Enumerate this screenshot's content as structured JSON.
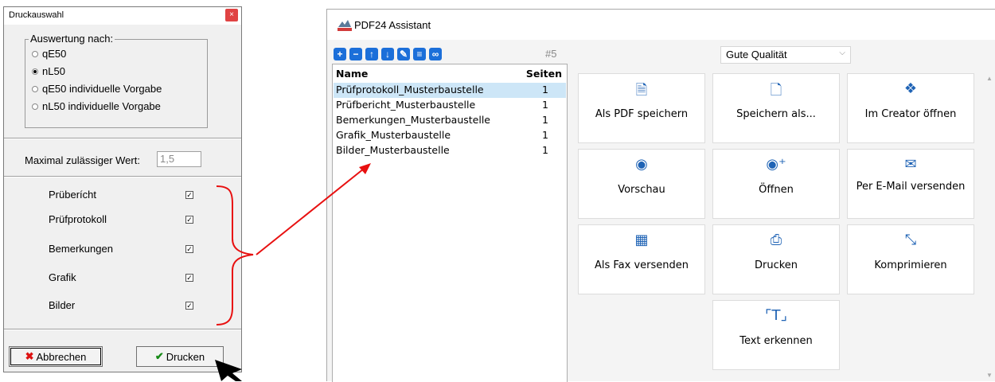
{
  "dialog": {
    "title": "Druckauswahl",
    "close_glyph": "×",
    "group_label": "Auswertung nach:",
    "radios": [
      {
        "label": "qE50",
        "selected": false
      },
      {
        "label": "nL50",
        "selected": true
      },
      {
        "label": "qE50 individuelle Vorgabe",
        "selected": false
      },
      {
        "label": "nL50 individuelle Vorgabe",
        "selected": false
      }
    ],
    "max_label": "Maximal zulässiger Wert:",
    "max_value": "1,5",
    "checkboxes": [
      {
        "label": "Prüberícht",
        "checked": true
      },
      {
        "label": "Prüfprotokoll",
        "checked": true
      },
      {
        "label": "Bemerkungen",
        "checked": true
      },
      {
        "label": "Grafik",
        "checked": true
      },
      {
        "label": "Bilder",
        "checked": true
      }
    ],
    "check_glyph": "✓",
    "cancel_label": "Abbrechen",
    "print_label": "Drucken"
  },
  "app": {
    "title": "PDF24 Assistant",
    "doc_count": "#5",
    "quality_value": "Gute Qualität",
    "list_headers": {
      "name": "Name",
      "pages": "Seiten"
    },
    "files": [
      {
        "name": "Prüfprotokoll_Musterbaustelle",
        "pages": "1",
        "selected": true
      },
      {
        "name": "Prüfbericht_Musterbaustelle",
        "pages": "1",
        "selected": false
      },
      {
        "name": "Bemerkungen_Musterbaustelle",
        "pages": "1",
        "selected": false
      },
      {
        "name": "Grafik_Musterbaustelle",
        "pages": "1",
        "selected": false
      },
      {
        "name": "Bilder_Musterbaustelle",
        "pages": "1",
        "selected": false
      }
    ],
    "toolbar_icons": [
      "add-icon",
      "remove-icon",
      "move-up-icon",
      "move-down-icon",
      "edit-icon",
      "properties-icon",
      "combine-icon"
    ],
    "actions": [
      {
        "label": "Als PDF speichern",
        "icon": "save-pdf-icon"
      },
      {
        "label": "Speichern als...",
        "icon": "save-as-icon"
      },
      {
        "label": "Im Creator öffnen",
        "icon": "creator-icon"
      },
      {
        "label": "Vorschau",
        "icon": "preview-icon"
      },
      {
        "label": "Öffnen",
        "icon": "open-icon"
      },
      {
        "label": "Per E-Mail versenden",
        "icon": "email-icon"
      },
      {
        "label": "Als Fax versenden",
        "icon": "fax-icon"
      },
      {
        "label": "Drucken",
        "icon": "print-icon"
      },
      {
        "label": "Komprimieren",
        "icon": "compress-icon"
      },
      {
        "label": "Text erkennen",
        "icon": "ocr-icon"
      }
    ],
    "accent_color": "#1f63b5",
    "selection_color": "#cde6f7"
  },
  "annotation_color": "#e81010"
}
